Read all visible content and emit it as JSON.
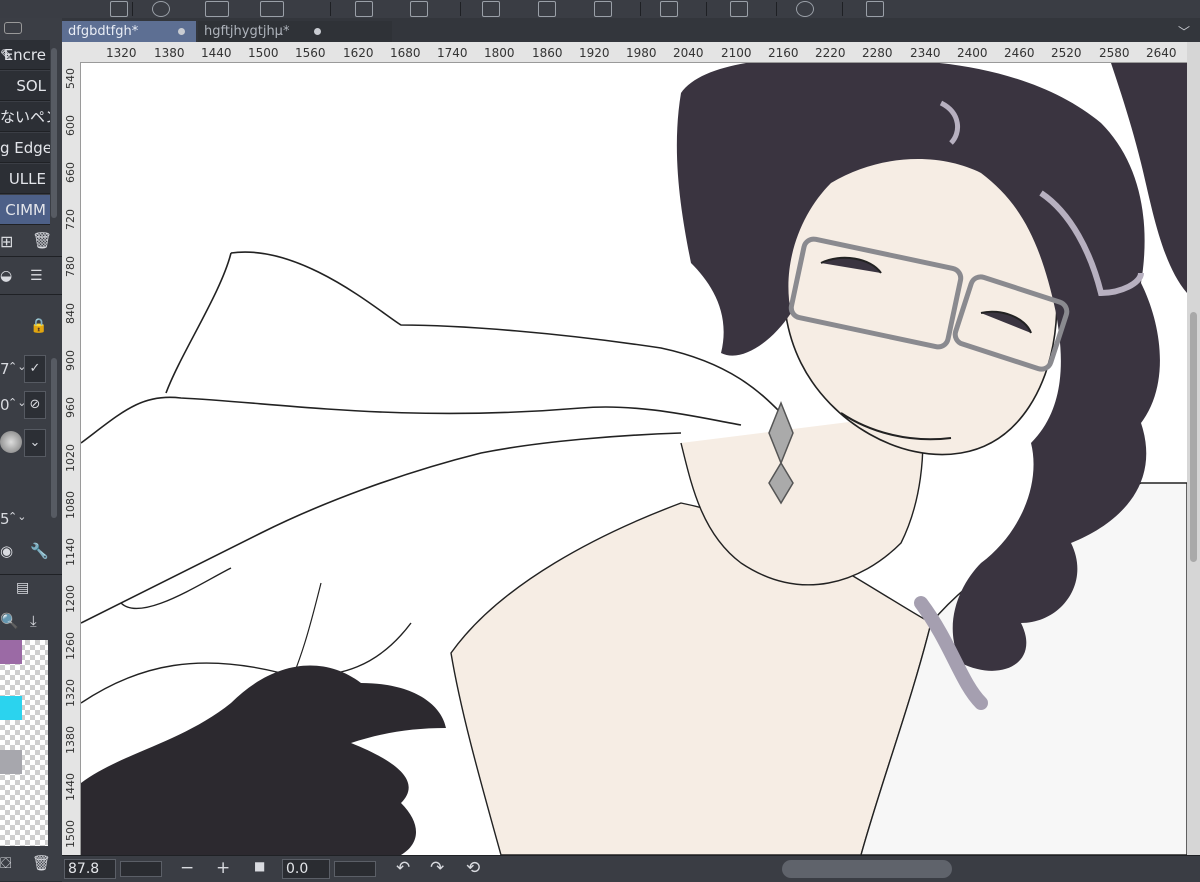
{
  "tabs": [
    {
      "label": "dfgbdtfgh*",
      "active": true
    },
    {
      "label": "hgftjhygtjhµ*",
      "active": false
    }
  ],
  "subtools": [
    {
      "label": "Encre"
    },
    {
      "label": "SOL"
    },
    {
      "label": "ないペン"
    },
    {
      "label": "g Edge"
    },
    {
      "label": "ULLE"
    },
    {
      "label": "CIMM",
      "selected": true
    }
  ],
  "tool_property": {
    "rows": [
      {
        "value": "7"
      },
      {
        "value": "0"
      },
      {
        "value": "5"
      }
    ]
  },
  "color_swatches": [
    "#9b6aa5",
    "#2bd3ee",
    "#a7a7ad"
  ],
  "ruler": {
    "h_labels": [
      "1320",
      "1380",
      "1440",
      "1500",
      "1560",
      "1620",
      "1680",
      "1740",
      "1800",
      "1860",
      "1920",
      "1980",
      "2040",
      "2100",
      "2160",
      "2220",
      "2280",
      "2340",
      "2400",
      "2460",
      "2520",
      "2580",
      "2640"
    ],
    "v_labels": [
      "540",
      "600",
      "660",
      "720",
      "780",
      "840",
      "900",
      "960",
      "1020",
      "1080",
      "1140",
      "1200",
      "1260",
      "1320",
      "1380",
      "1440",
      "1500"
    ]
  },
  "statusbar": {
    "zoom_value": "87.8",
    "zoom_out": "−",
    "zoom_in": "+",
    "rotation_value": "0.0"
  },
  "colors": {
    "accent": "#5d6f93",
    "skin": "#f6ede4",
    "hair": "#3a3440",
    "glove": "#2c292f"
  }
}
